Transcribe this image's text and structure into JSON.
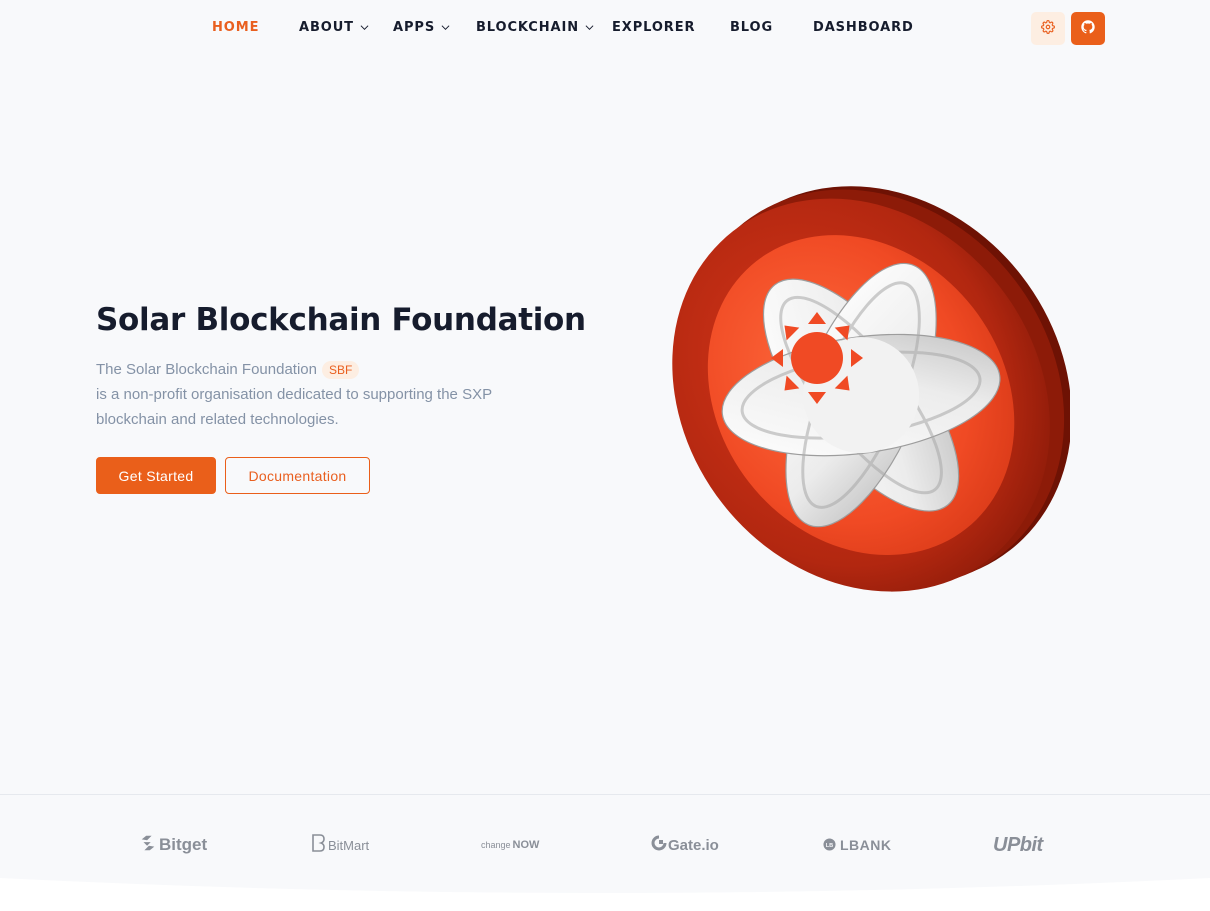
{
  "nav": {
    "items": [
      {
        "label": "HOME",
        "active": true,
        "dropdown": false
      },
      {
        "label": "ABOUT",
        "active": false,
        "dropdown": true
      },
      {
        "label": "APPS",
        "active": false,
        "dropdown": true
      },
      {
        "label": "BLOCKCHAIN",
        "active": false,
        "dropdown": true
      },
      {
        "label": "EXPLORER",
        "active": false,
        "dropdown": false
      },
      {
        "label": "BLOG",
        "active": false,
        "dropdown": false
      },
      {
        "label": "DASHBOARD",
        "active": false,
        "dropdown": false
      }
    ],
    "settings_icon": "gear-icon",
    "github_icon": "github-icon"
  },
  "hero": {
    "title": "Solar Blockchain Foundation",
    "desc_prefix": "The Solar Blockchain Foundation",
    "badge": "SBF",
    "desc_line2": "is a non-profit organisation dedicated to supporting the SXP",
    "desc_line3": "blockchain and related technologies.",
    "primary_button": "Get Started",
    "secondary_button": "Documentation",
    "image_icon": "solar-coin-illustration"
  },
  "partners": [
    {
      "name": "Bitget",
      "icon": "bitget-logo"
    },
    {
      "name": "BitMart",
      "icon": "bitmart-logo"
    },
    {
      "name_small": "change",
      "name": "NOW",
      "icon": "changenow-logo"
    },
    {
      "name": "Gate.io",
      "icon": "gateio-logo"
    },
    {
      "name": "LBANK",
      "icon": "lbank-logo"
    },
    {
      "name": "UPbit",
      "icon": "upbit-logo"
    }
  ],
  "colors": {
    "accent": "#ea5f1a",
    "accent_light": "#fdeee2",
    "text_dark": "#161c2d",
    "text_muted": "#8492a6",
    "background": "#f8f9fb",
    "coin_red": "#c62d12"
  }
}
